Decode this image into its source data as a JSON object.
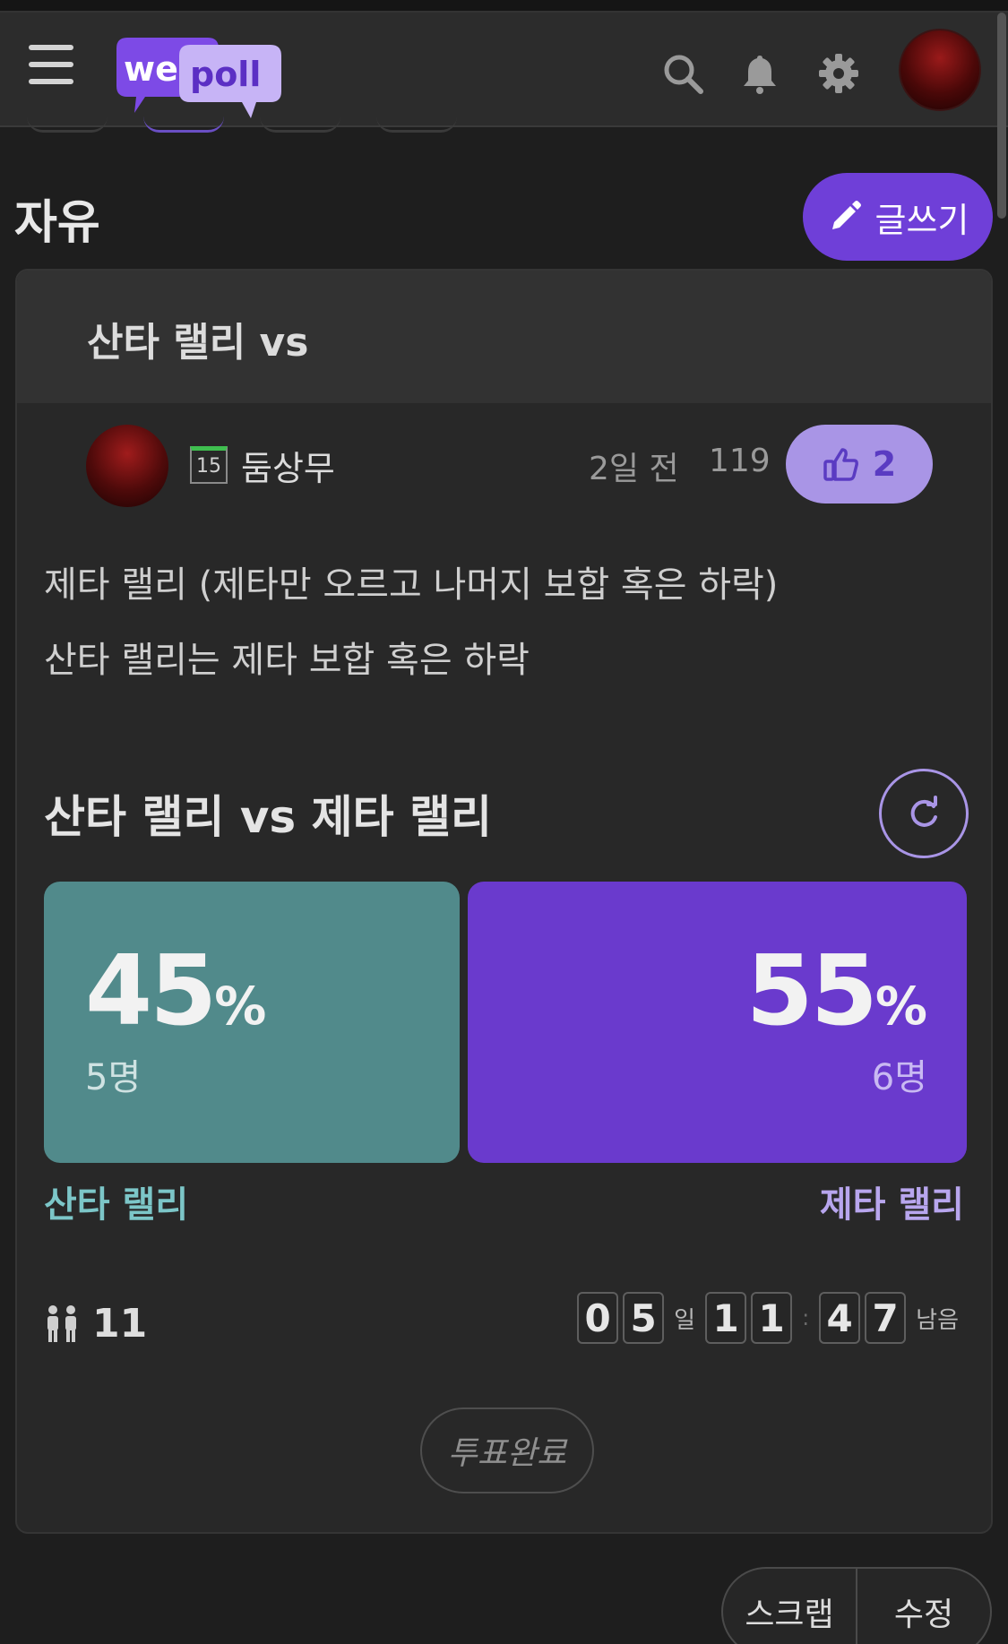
{
  "header": {
    "logo_we": "we",
    "logo_poll": "poll",
    "icons": [
      "menu-icon",
      "search-icon",
      "bell-icon",
      "gear-icon",
      "avatar"
    ]
  },
  "board": {
    "title": "자유",
    "write_label": "글쓰기"
  },
  "post": {
    "title": "산타 랠리 vs",
    "author": {
      "level": "15",
      "name": "둠상무"
    },
    "time": "2일 전",
    "views": "119",
    "likes": "2",
    "body": [
      "제타 랠리 (제타만 오르고 나머지 보합 혹은 하락)",
      "산타 랠리는 제타 보합 혹은 하락"
    ]
  },
  "poll": {
    "title": "산타 랠리 vs 제타 랠리",
    "option_a": {
      "percent": "45",
      "percent_unit": "%",
      "count": "5명",
      "label": "산타 랠리",
      "color": "#518a8b"
    },
    "option_b": {
      "percent": "55",
      "percent_unit": "%",
      "count": "6명",
      "label": "제타 랠리",
      "color": "#6a3acd"
    },
    "voters": "11",
    "countdown": {
      "day_digits": [
        "0",
        "5"
      ],
      "day_unit": "일",
      "hour_digits": [
        "1",
        "1"
      ],
      "colon": ":",
      "min_digits": [
        "4",
        "7"
      ],
      "remaining_label": "남음"
    },
    "status_label": "투표완료"
  },
  "actions": {
    "scrap_label": "스크랩",
    "edit_label": "수정"
  },
  "colors": {
    "accent": "#6f3fd8",
    "like_bg": "#a995e6",
    "background": "#1e1e1e"
  }
}
